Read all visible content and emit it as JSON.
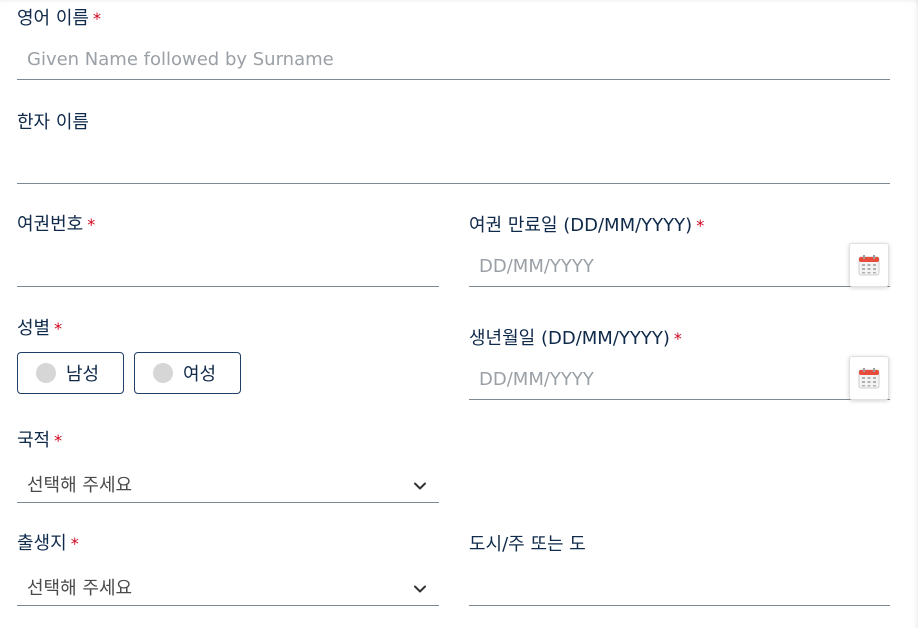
{
  "english_name": {
    "label": "영어 이름",
    "required_mark": "*",
    "placeholder": "Given Name followed by Surname",
    "value": ""
  },
  "hanja_name": {
    "label": "한자 이름",
    "value": ""
  },
  "passport_number": {
    "label": "여권번호",
    "required_mark": "*",
    "value": ""
  },
  "passport_expiry": {
    "label": "여권 만료일 (DD/MM/YYYY)",
    "required_mark": "*",
    "placeholder": "DD/MM/YYYY",
    "icon": "calendar-icon"
  },
  "gender": {
    "label": "성별",
    "required_mark": "*",
    "options": [
      {
        "label": "남성",
        "selected": false
      },
      {
        "label": "여성",
        "selected": false
      }
    ]
  },
  "birth_date": {
    "label": "생년월일 (DD/MM/YYYY)",
    "required_mark": "*",
    "placeholder": "DD/MM/YYYY",
    "icon": "calendar-icon"
  },
  "nationality": {
    "label": "국적",
    "required_mark": "*",
    "selected": "선택해 주세요"
  },
  "birthplace": {
    "label": "출생지",
    "required_mark": "*",
    "selected": "선택해 주세요"
  },
  "city_state": {
    "label": "도시/주 또는 도",
    "value": ""
  },
  "colors": {
    "label": "#0f2a4a",
    "required": "#d0021b",
    "underline": "#7d8a96",
    "placeholder": "#9aa0a6",
    "calendar_accent": "#e74c3c"
  }
}
